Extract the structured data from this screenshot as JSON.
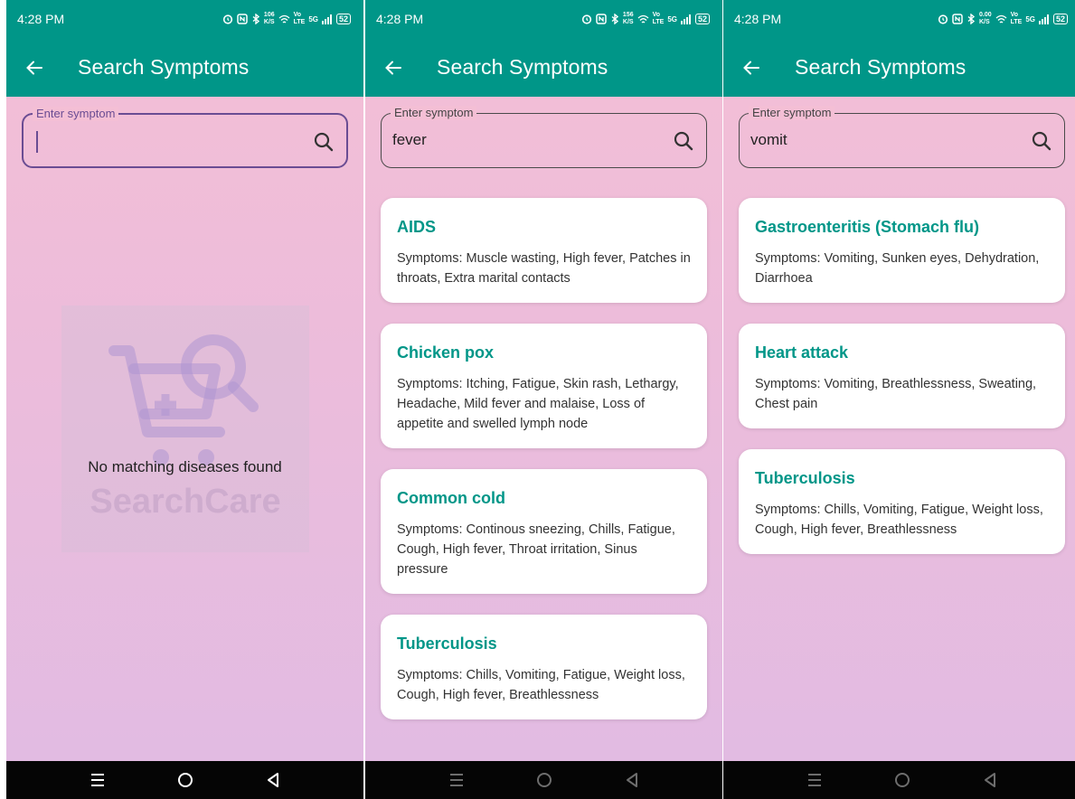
{
  "colors": {
    "primary": "#009688",
    "focus_border": "#6a4c93",
    "title_teal": "#009688"
  },
  "screens": [
    {
      "status": {
        "time": "4:28 PM",
        "speed_top": "106",
        "speed_bottom": "K/S",
        "net_top": "Vo",
        "net_bottom": "LTE",
        "signal": "5G",
        "battery": "52"
      },
      "appbar": {
        "title": "Search Symptoms",
        "back_icon": "arrow-left-icon"
      },
      "search": {
        "label": "Enter symptom",
        "value": "",
        "focused": true
      },
      "empty": {
        "message": "No matching diseases found",
        "watermark": "SearchCare"
      },
      "results": []
    },
    {
      "status": {
        "time": "4:28 PM",
        "speed_top": "156",
        "speed_bottom": "K/S",
        "net_top": "Vo",
        "net_bottom": "LTE",
        "signal": "5G",
        "battery": "52"
      },
      "appbar": {
        "title": "Search Symptoms",
        "back_icon": "arrow-left-icon"
      },
      "search": {
        "label": "Enter symptom",
        "value": "fever",
        "focused": false
      },
      "results": [
        {
          "name": "AIDS",
          "symptoms": "Symptoms: Muscle wasting, High fever, Patches in throats, Extra marital contacts"
        },
        {
          "name": "Chicken pox",
          "symptoms": "Symptoms: Itching, Fatigue, Skin rash, Lethargy, Headache, Mild fever and malaise, Loss of appetite and swelled lymph node"
        },
        {
          "name": "Common cold",
          "symptoms": "Symptoms: Continous sneezing, Chills, Fatigue, Cough, High fever, Throat irritation, Sinus pressure"
        },
        {
          "name": "Tuberculosis",
          "symptoms": "Symptoms: Chills, Vomiting, Fatigue, Weight loss, Cough, High fever, Breathlessness"
        }
      ]
    },
    {
      "status": {
        "time": "4:28 PM",
        "speed_top": "0.00",
        "speed_bottom": "K/S",
        "net_top": "Vo",
        "net_bottom": "LTE",
        "signal": "5G",
        "battery": "52"
      },
      "appbar": {
        "title": "Search Symptoms",
        "back_icon": "arrow-left-icon"
      },
      "search": {
        "label": "Enter symptom",
        "value": "vomit",
        "focused": false
      },
      "results": [
        {
          "name": "Gastroenteritis (Stomach flu)",
          "symptoms": "Symptoms: Vomiting, Sunken eyes, Dehydration, Diarrhoea"
        },
        {
          "name": "Heart attack",
          "symptoms": "Symptoms: Vomiting, Breathlessness, Sweating, Chest pain"
        },
        {
          "name": "Tuberculosis",
          "symptoms": "Symptoms: Chills, Vomiting, Fatigue, Weight loss, Cough, High fever, Breathlessness"
        }
      ]
    }
  ],
  "navbar": {
    "icons": [
      "menu-icon",
      "home-circle-icon",
      "back-triangle-icon"
    ]
  }
}
